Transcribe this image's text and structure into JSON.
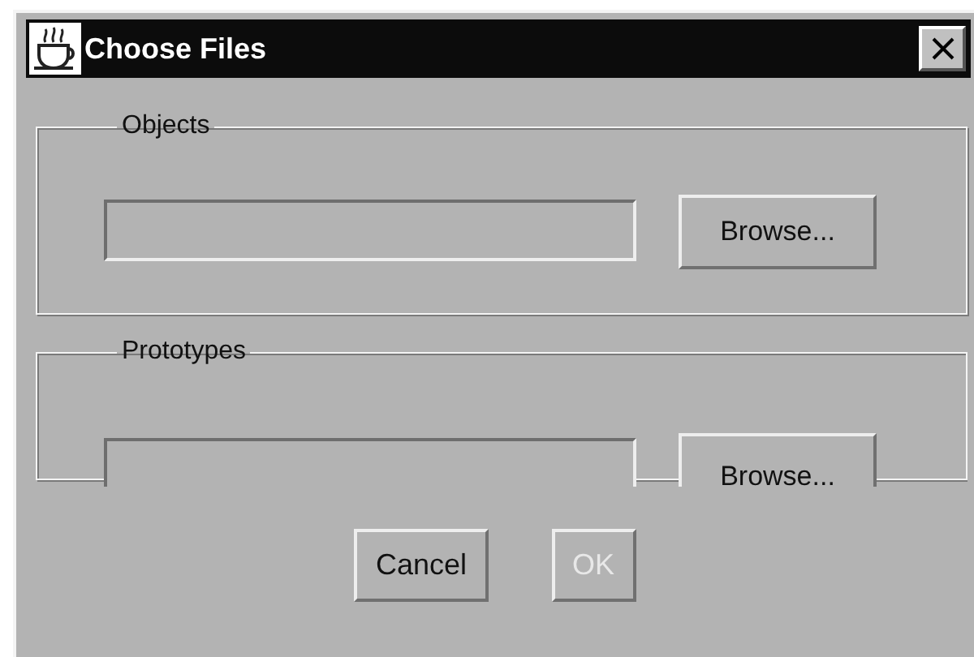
{
  "window": {
    "title": "Choose Files"
  },
  "groups": [
    {
      "label": "Objects",
      "button": "Browse...",
      "clipped": false
    },
    {
      "label": "Prototypes",
      "button": "Browse...",
      "clipped": true
    }
  ],
  "buttons": [
    {
      "label": "Cancel",
      "disabled": false
    },
    {
      "label": "OK",
      "disabled": true
    }
  ]
}
